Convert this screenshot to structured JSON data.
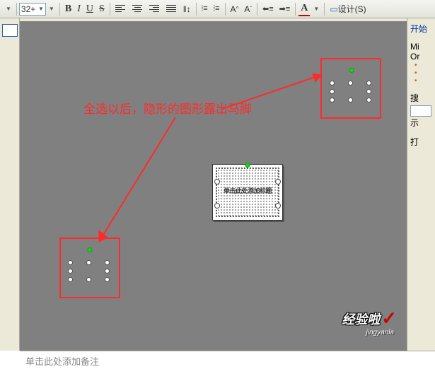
{
  "toolbar": {
    "font_size": "32+",
    "bold": "B",
    "italic": "I",
    "underline": "U",
    "strike": "S",
    "superscript_a": "A",
    "subscript_a": "A",
    "font_a": "A",
    "design": "设计(S)"
  },
  "annotation_text": "全选以后，隐形的图形露出马脚",
  "center_shape_text": "单击此处添加标题",
  "notes_placeholder": "单击此处添加备注",
  "sidebar_right": {
    "start": "开始",
    "letter1": "Mi",
    "letter2": "Or",
    "search_label": "搜",
    "show_label": "示",
    "open_label": "打"
  },
  "watermark": {
    "text": "经验啦",
    "url": "jingyanla"
  }
}
